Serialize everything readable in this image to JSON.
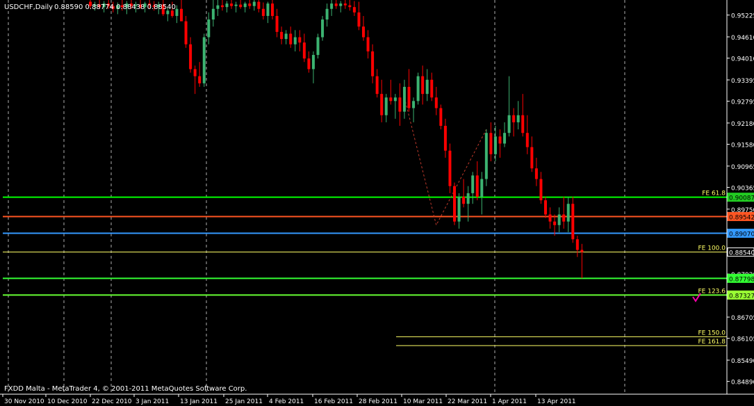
{
  "header": {
    "symbol": "USDCHF,Daily",
    "ohlc": "0.88590 0.88774 0.88438 0.88540"
  },
  "footer": {
    "copyright": "FXDD Malta - MetaTrader 4, © 2001-2011 MetaQuotes Software Corp."
  },
  "colors": {
    "background": "#000000",
    "bull_candle": "#3CB371",
    "bear_candle": "#FF0000",
    "grid": "#B0B0B0",
    "axis_text": "#FFFFFF",
    "fe_text": "#FFFF66",
    "fe_line": "#FFFF66",
    "zigzag": "#C0392B",
    "check": "#FF00AA"
  },
  "chart_data": {
    "type": "candlestick",
    "y_range": [
      0.8453,
      0.9565
    ],
    "y_ticks": [
      "0.95225",
      "0.94610",
      "0.94010",
      "0.93395",
      "0.92795",
      "0.92180",
      "0.91580",
      "0.90965",
      "0.90365",
      "0.89750",
      "0.89150",
      "0.88535",
      "0.87920",
      "0.87320",
      "0.86705",
      "0.86105",
      "0.85490",
      "0.84890"
    ],
    "x_ticks": [
      {
        "i": 0,
        "label": "30 Nov 2010"
      },
      {
        "i": 8,
        "label": "10 Dec 2010"
      },
      {
        "i": 16,
        "label": "22 Dec 2010"
      },
      {
        "i": 24,
        "label": "3 Jan 2011"
      },
      {
        "i": 32,
        "label": "13 Jan 2011"
      },
      {
        "i": 40,
        "label": "25 Jan 2011"
      },
      {
        "i": 48,
        "label": "4 Feb 2011"
      },
      {
        "i": 56,
        "label": "16 Feb 2011"
      },
      {
        "i": 64,
        "label": "28 Feb 2011"
      },
      {
        "i": 72,
        "label": "10 Mar 2011"
      },
      {
        "i": 80,
        "label": "22 Mar 2011"
      },
      {
        "i": 88,
        "label": "1 Apr 2011"
      },
      {
        "i": 96,
        "label": "13 Apr 2011"
      }
    ],
    "vertical_grid_i": [
      1,
      13,
      23,
      44,
      88,
      111
    ],
    "candles": [
      [
        0.956,
        0.9565,
        0.954,
        0.9548
      ],
      [
        0.9548,
        0.956,
        0.9535,
        0.9552
      ],
      [
        0.9552,
        0.9565,
        0.954,
        0.9545
      ],
      [
        0.9545,
        0.9562,
        0.953,
        0.9555
      ],
      [
        0.9555,
        0.9565,
        0.954,
        0.9548
      ],
      [
        0.9548,
        0.956,
        0.953,
        0.954
      ],
      [
        0.954,
        0.9558,
        0.9525,
        0.955
      ],
      [
        0.955,
        0.9565,
        0.9535,
        0.9545
      ],
      [
        0.9545,
        0.9562,
        0.9525,
        0.9555
      ],
      [
        0.9555,
        0.9565,
        0.954,
        0.9548
      ],
      [
        0.9548,
        0.956,
        0.953,
        0.9552
      ],
      [
        0.9552,
        0.9565,
        0.954,
        0.9545
      ],
      [
        0.9545,
        0.956,
        0.953,
        0.9555
      ],
      [
        0.9555,
        0.9565,
        0.954,
        0.955
      ],
      [
        0.955,
        0.9562,
        0.9535,
        0.9545
      ],
      [
        0.9545,
        0.956,
        0.9525,
        0.9552
      ],
      [
        0.9552,
        0.9565,
        0.952,
        0.9525
      ],
      [
        0.9525,
        0.9545,
        0.9505,
        0.9535
      ],
      [
        0.9535,
        0.956,
        0.9515,
        0.952
      ],
      [
        0.952,
        0.955,
        0.95,
        0.954
      ],
      [
        0.954,
        0.9565,
        0.952,
        0.9505
      ],
      [
        0.9505,
        0.952,
        0.943,
        0.944
      ],
      [
        0.944,
        0.946,
        0.936,
        0.937
      ],
      [
        0.937,
        0.938,
        0.93,
        0.935
      ],
      [
        0.935,
        0.939,
        0.932,
        0.933
      ],
      [
        0.933,
        0.947,
        0.932,
        0.946
      ],
      [
        0.946,
        0.953,
        0.944,
        0.951
      ],
      [
        0.951,
        0.9565,
        0.949,
        0.954
      ],
      [
        0.954,
        0.9565,
        0.952,
        0.955
      ],
      [
        0.955,
        0.9565,
        0.9535,
        0.9545
      ],
      [
        0.9545,
        0.9562,
        0.953,
        0.9555
      ],
      [
        0.9555,
        0.9565,
        0.954,
        0.9548
      ],
      [
        0.9548,
        0.956,
        0.953,
        0.9552
      ],
      [
        0.9552,
        0.9565,
        0.954,
        0.9545
      ],
      [
        0.9545,
        0.956,
        0.953,
        0.9555
      ],
      [
        0.9555,
        0.9565,
        0.954,
        0.9548
      ],
      [
        0.9548,
        0.9565,
        0.9535,
        0.956
      ],
      [
        0.956,
        0.9565,
        0.953,
        0.954
      ],
      [
        0.954,
        0.9558,
        0.951,
        0.952
      ],
      [
        0.952,
        0.956,
        0.95,
        0.9555
      ],
      [
        0.9555,
        0.9565,
        0.951,
        0.952
      ],
      [
        0.952,
        0.954,
        0.946,
        0.9475
      ],
      [
        0.9475,
        0.949,
        0.944,
        0.9455
      ],
      [
        0.9455,
        0.948,
        0.944,
        0.947
      ],
      [
        0.947,
        0.949,
        0.943,
        0.944
      ],
      [
        0.944,
        0.948,
        0.942,
        0.946
      ],
      [
        0.946,
        0.948,
        0.942,
        0.9445
      ],
      [
        0.9445,
        0.947,
        0.939,
        0.94
      ],
      [
        0.94,
        0.942,
        0.936,
        0.937
      ],
      [
        0.937,
        0.942,
        0.933,
        0.941
      ],
      [
        0.941,
        0.947,
        0.94,
        0.946
      ],
      [
        0.946,
        0.952,
        0.945,
        0.951
      ],
      [
        0.951,
        0.9555,
        0.949,
        0.954
      ],
      [
        0.954,
        0.9565,
        0.952,
        0.9555
      ],
      [
        0.9555,
        0.9565,
        0.954,
        0.9548
      ],
      [
        0.9548,
        0.9562,
        0.953,
        0.9555
      ],
      [
        0.9555,
        0.9565,
        0.954,
        0.955
      ],
      [
        0.955,
        0.9565,
        0.9535,
        0.9545
      ],
      [
        0.9545,
        0.9562,
        0.952,
        0.953
      ],
      [
        0.953,
        0.956,
        0.948,
        0.949
      ],
      [
        0.949,
        0.952,
        0.945,
        0.946
      ],
      [
        0.946,
        0.948,
        0.94,
        0.942
      ],
      [
        0.942,
        0.944,
        0.933,
        0.935
      ],
      [
        0.935,
        0.937,
        0.929,
        0.93
      ],
      [
        0.93,
        0.934,
        0.922,
        0.924
      ],
      [
        0.924,
        0.93,
        0.922,
        0.929
      ],
      [
        0.929,
        0.934,
        0.927,
        0.928
      ],
      [
        0.928,
        0.93,
        0.923,
        0.929
      ],
      [
        0.929,
        0.933,
        0.921,
        0.925
      ],
      [
        0.925,
        0.934,
        0.923,
        0.932
      ],
      [
        0.932,
        0.937,
        0.925,
        0.926
      ],
      [
        0.926,
        0.929,
        0.922,
        0.928
      ],
      [
        0.928,
        0.936,
        0.927,
        0.935
      ],
      [
        0.935,
        0.938,
        0.927,
        0.93
      ],
      [
        0.93,
        0.937,
        0.928,
        0.934
      ],
      [
        0.934,
        0.936,
        0.928,
        0.929
      ],
      [
        0.929,
        0.932,
        0.924,
        0.926
      ],
      [
        0.926,
        0.927,
        0.92,
        0.921
      ],
      [
        0.921,
        0.923,
        0.912,
        0.914
      ],
      [
        0.914,
        0.916,
        0.902,
        0.904
      ],
      [
        0.904,
        0.905,
        0.893,
        0.894
      ],
      [
        0.894,
        0.902,
        0.892,
        0.901
      ],
      [
        0.901,
        0.906,
        0.898,
        0.899
      ],
      [
        0.899,
        0.904,
        0.894,
        0.902
      ],
      [
        0.902,
        0.908,
        0.899,
        0.907
      ],
      [
        0.907,
        0.911,
        0.9,
        0.901
      ],
      [
        0.901,
        0.908,
        0.896,
        0.906
      ],
      [
        0.906,
        0.92,
        0.904,
        0.919
      ],
      [
        0.919,
        0.922,
        0.911,
        0.913
      ],
      [
        0.913,
        0.921,
        0.911,
        0.918
      ],
      [
        0.918,
        0.92,
        0.912,
        0.916
      ],
      [
        0.916,
        0.922,
        0.915,
        0.919
      ],
      [
        0.919,
        0.935,
        0.918,
        0.924
      ],
      [
        0.924,
        0.926,
        0.918,
        0.922
      ],
      [
        0.922,
        0.928,
        0.92,
        0.924
      ],
      [
        0.924,
        0.93,
        0.918,
        0.919
      ],
      [
        0.919,
        0.924,
        0.913,
        0.915
      ],
      [
        0.915,
        0.918,
        0.908,
        0.909
      ],
      [
        0.909,
        0.912,
        0.904,
        0.906
      ],
      [
        0.906,
        0.908,
        0.899,
        0.9
      ],
      [
        0.9,
        0.901,
        0.895,
        0.896
      ],
      [
        0.896,
        0.898,
        0.892,
        0.894
      ],
      [
        0.894,
        0.896,
        0.89,
        0.893
      ],
      [
        0.893,
        0.898,
        0.891,
        0.896
      ],
      [
        0.896,
        0.901,
        0.892,
        0.894
      ],
      [
        0.894,
        0.901,
        0.891,
        0.899
      ],
      [
        0.899,
        0.901,
        0.888,
        0.889
      ],
      [
        0.889,
        0.89,
        0.884,
        0.886
      ],
      [
        0.886,
        0.8877,
        0.878,
        0.8854
      ]
    ],
    "levels": [
      {
        "price": 0.90087,
        "color": "#00FF00",
        "width": 2,
        "full": true,
        "tag": "0.90087",
        "tag_bg": "#22CC22",
        "tag_fg": "#000000",
        "label": "FE 61.8"
      },
      {
        "price": 0.89542,
        "color": "#FF5522",
        "width": 2,
        "full": true,
        "tag": "0.89542",
        "tag_bg": "#FF5522",
        "tag_fg": "#000000",
        "label": ""
      },
      {
        "price": 0.8907,
        "color": "#3399FF",
        "width": 2,
        "full": true,
        "tag": "0.89070",
        "tag_bg": "#3399FF",
        "tag_fg": "#000000",
        "label": ""
      },
      {
        "price": 0.8854,
        "color": "#FFFF66",
        "width": 1,
        "full": true,
        "tag": "0.88540",
        "tag_bg": "#000000",
        "tag_fg": "#FFFFFF",
        "label": "FE 100.0"
      },
      {
        "price": 0.87798,
        "color": "#33FF33",
        "width": 2,
        "full": true,
        "tag": "0.87798",
        "tag_bg": "#33FF33",
        "tag_fg": "#000000",
        "label": ""
      },
      {
        "price": 0.87327,
        "color": "#66FF33",
        "width": 2,
        "full": true,
        "tag": "0.87327",
        "tag_bg": "#99FF33",
        "tag_fg": "#000000",
        "label": "FE 123.6"
      },
      {
        "price": 0.8615,
        "color": "#FFFF66",
        "width": 1,
        "full": false,
        "tag": "",
        "label": "FE 150.0"
      },
      {
        "price": 0.859,
        "color": "#FFFF66",
        "width": 1,
        "full": false,
        "tag": "",
        "label": "FE 161.8"
      }
    ],
    "zigzag": [
      {
        "i": 69,
        "price": 0.929
      },
      {
        "i": 76,
        "price": 0.893
      },
      {
        "i": 87,
        "price": 0.92
      }
    ]
  }
}
